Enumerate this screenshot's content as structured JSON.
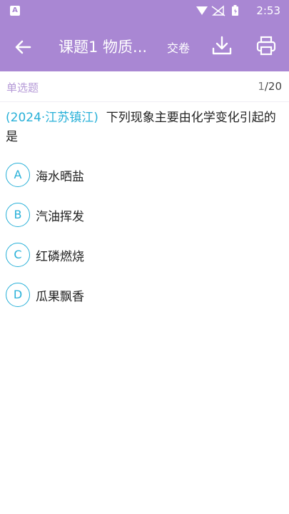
{
  "status_bar": {
    "time": "2:53",
    "notification_icon": "A"
  },
  "toolbar": {
    "title": "课题1 物质...",
    "submit_label": "交卷"
  },
  "subbar": {
    "question_type": "单选题",
    "current": "1",
    "total": "/20"
  },
  "question": {
    "source": "(2024·江苏镇江)",
    "text": "下列现象主要由化学变化引起的是"
  },
  "options": [
    {
      "letter": "A",
      "text": "海水晒盐"
    },
    {
      "letter": "B",
      "text": "汽油挥发"
    },
    {
      "letter": "C",
      "text": "红磷燃烧"
    },
    {
      "letter": "D",
      "text": "瓜果飘香"
    }
  ],
  "colors": {
    "accent": "#a987d3",
    "option": "#27b0d8"
  }
}
